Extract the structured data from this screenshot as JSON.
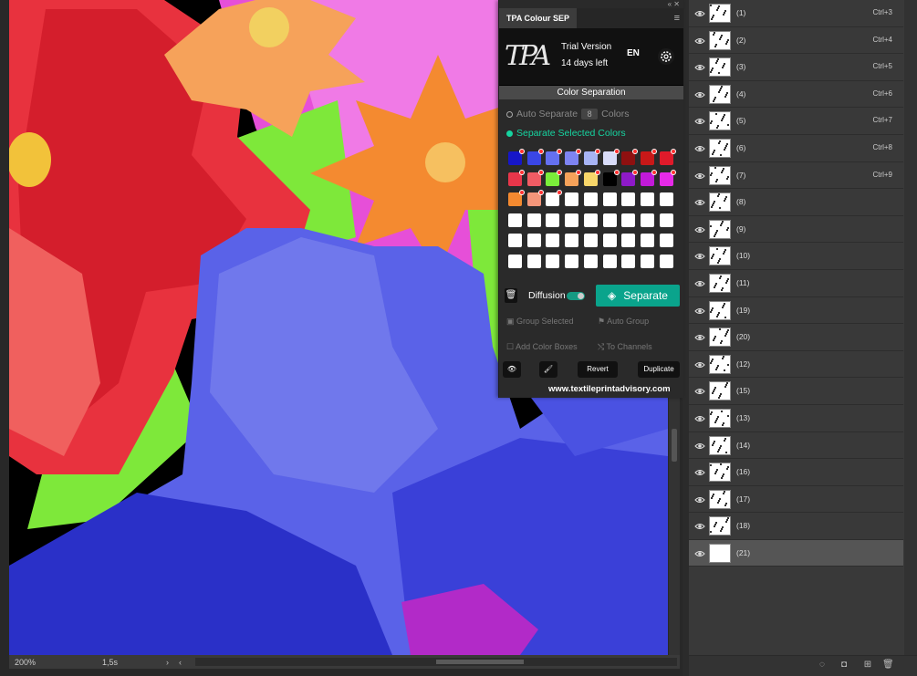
{
  "status": {
    "zoom": "200%",
    "doc_info": "1,5s",
    "left_arrow": "›",
    "right_arrow": "‹"
  },
  "plugin": {
    "window_controls": "«  ✕",
    "tab_title": "TPA Colour SEP",
    "logo_text": "TPA",
    "trial_line1": "Trial Version",
    "trial_line2": "14 days left",
    "language": "EN",
    "section_title": "Color Separation",
    "auto_separate_label": "Auto Separate",
    "auto_separate_count": "8",
    "colors_label": "Colors",
    "separate_selected_label": "Separate Selected Colors",
    "swatches": [
      {
        "color": "#1616c8",
        "marked": true
      },
      {
        "color": "#3a46e6",
        "marked": true
      },
      {
        "color": "#6470f0",
        "marked": true
      },
      {
        "color": "#7e84f2",
        "marked": true
      },
      {
        "color": "#a7b4f5",
        "marked": true
      },
      {
        "color": "#d8dcf8",
        "marked": true
      },
      {
        "color": "#8e1010",
        "marked": true
      },
      {
        "color": "#c81818",
        "marked": true
      },
      {
        "color": "#e01a2a",
        "marked": true
      },
      {
        "color": "#e8364a",
        "marked": true
      },
      {
        "color": "#f05c64",
        "marked": true
      },
      {
        "color": "#7bee3a",
        "marked": true
      },
      {
        "color": "#f6a25a",
        "marked": true
      },
      {
        "color": "#f7d66a",
        "marked": true
      },
      {
        "color": "#000000",
        "marked": true
      },
      {
        "color": "#8e1ac8",
        "marked": true
      },
      {
        "color": "#c21ad8",
        "marked": true
      },
      {
        "color": "#e62ae8",
        "marked": true
      },
      {
        "color": "#f48a30",
        "marked": true
      },
      {
        "color": "#f4967a",
        "marked": true
      },
      {
        "color": "#ffffff",
        "marked": true
      },
      {
        "color": "#ffffff",
        "marked": false
      },
      {
        "color": "#ffffff",
        "marked": false
      },
      {
        "color": "#ffffff",
        "marked": false
      },
      {
        "color": "#ffffff",
        "marked": false
      },
      {
        "color": "#ffffff",
        "marked": false
      },
      {
        "color": "#ffffff",
        "marked": false
      }
    ],
    "empty_swatch_count": 27,
    "diffusion_label": "Diffusion",
    "separate_button": "Separate",
    "group_selected": "Group Selected",
    "auto_group": "Auto Group",
    "add_color_boxes": "Add Color Boxes",
    "to_channels": "To Channels",
    "revert_button": "Revert",
    "duplicate_button": "Duplicate",
    "website": "www.textileprintadvisory.com"
  },
  "layers": [
    {
      "name": "(1)",
      "shortcut": "Ctrl+3"
    },
    {
      "name": "(2)",
      "shortcut": "Ctrl+4"
    },
    {
      "name": "(3)",
      "shortcut": "Ctrl+5"
    },
    {
      "name": "(4)",
      "shortcut": "Ctrl+6"
    },
    {
      "name": "(5)",
      "shortcut": "Ctrl+7"
    },
    {
      "name": "(6)",
      "shortcut": "Ctrl+8"
    },
    {
      "name": "(7)",
      "shortcut": "Ctrl+9"
    },
    {
      "name": "(8)",
      "shortcut": ""
    },
    {
      "name": "(9)",
      "shortcut": ""
    },
    {
      "name": "(10)",
      "shortcut": ""
    },
    {
      "name": "(11)",
      "shortcut": ""
    },
    {
      "name": "(19)",
      "shortcut": ""
    },
    {
      "name": "(20)",
      "shortcut": ""
    },
    {
      "name": "(12)",
      "shortcut": ""
    },
    {
      "name": "(15)",
      "shortcut": ""
    },
    {
      "name": "(13)",
      "shortcut": ""
    },
    {
      "name": "(14)",
      "shortcut": ""
    },
    {
      "name": "(16)",
      "shortcut": ""
    },
    {
      "name": "(17)",
      "shortcut": ""
    },
    {
      "name": "(18)",
      "shortcut": ""
    },
    {
      "name": "(21)",
      "shortcut": "",
      "selected": true
    }
  ],
  "colors": {
    "accent": "#0aa48c",
    "accent_text": "#16d4a0"
  }
}
